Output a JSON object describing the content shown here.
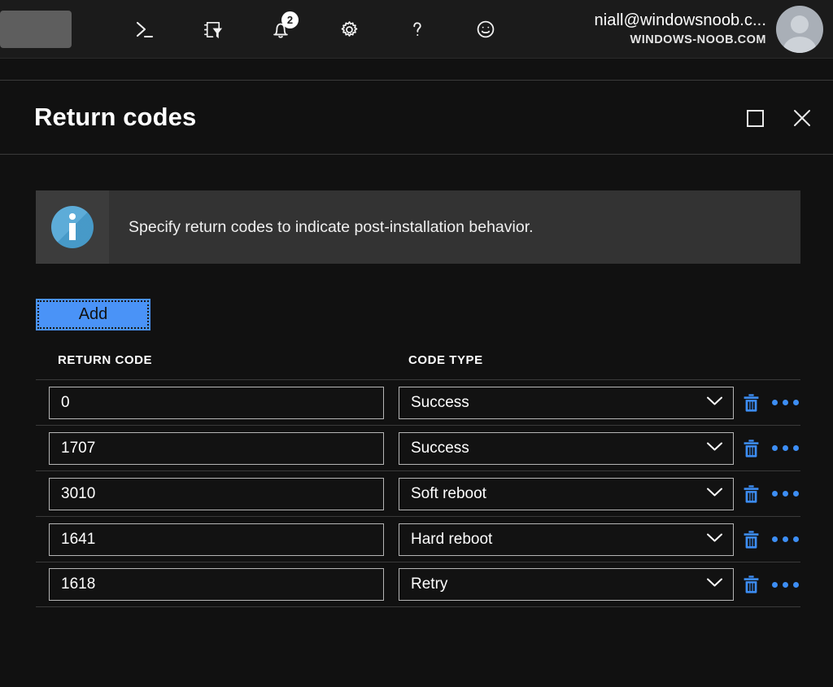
{
  "topbar": {
    "brand_placeholder": "",
    "icons": [
      {
        "name": "cloud-shell-icon",
        "label": "Cloud Shell"
      },
      {
        "name": "directories-filter-icon",
        "label": "Directories + subscriptions"
      },
      {
        "name": "notifications-bell-icon",
        "label": "Notifications",
        "badge": "2"
      },
      {
        "name": "settings-gear-icon",
        "label": "Settings"
      },
      {
        "name": "help-question-icon",
        "label": "Help"
      },
      {
        "name": "feedback-smiley-icon",
        "label": "Feedback"
      }
    ],
    "account": {
      "upn": "niall@windowsnoob.c...",
      "tenant": "WINDOWS-NOOB.COM"
    }
  },
  "blade": {
    "title": "Return codes",
    "maximize_label": "Maximize",
    "close_label": "Close"
  },
  "banner": {
    "icon": "info-icon",
    "message": "Specify return codes to indicate post-installation behavior."
  },
  "toolbar": {
    "add_label": "Add"
  },
  "table": {
    "columns": [
      "RETURN CODE",
      "CODE TYPE"
    ],
    "rows": [
      {
        "code": "0",
        "type": "Success"
      },
      {
        "code": "1707",
        "type": "Success"
      },
      {
        "code": "3010",
        "type": "Soft reboot"
      },
      {
        "code": "1641",
        "type": "Hard reboot"
      },
      {
        "code": "1618",
        "type": "Retry"
      }
    ],
    "code_placeholder": "Return code",
    "delete_label": "Delete",
    "more_label": "More"
  },
  "colors": {
    "accent_blue": "#4a93f7",
    "action_blue": "#3d8ef5",
    "info_blue": "#4ba3d4",
    "page_bg": "#111111",
    "topbar_bg": "#1b1b1b",
    "banner_bg": "#333333"
  }
}
